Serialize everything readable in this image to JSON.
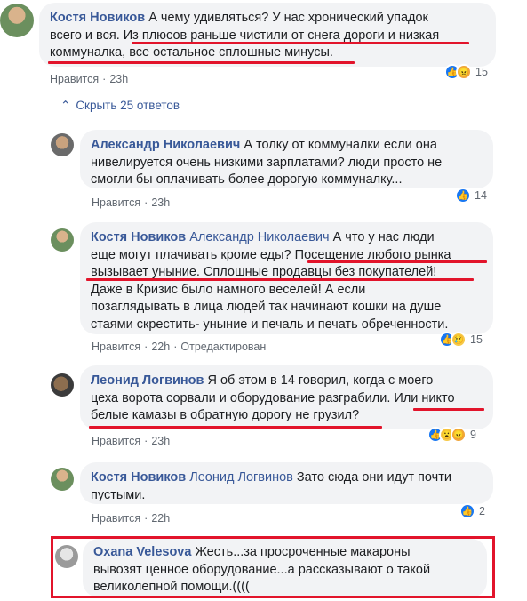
{
  "comments": [
    {
      "author": "Костя Новиков",
      "lines": [
        "А чему удивляться? У нас хронический упадок",
        "всего и вся. Из плюсов раньше чистили от снега дороги и низкая",
        "коммуналка, все остальное сплошные минусы."
      ],
      "line1": "А чему удивляться? У нас хронический упадок",
      "line2a": "всего и вся. ",
      "line2b": "Из плюсов раньше чистили от снега дороги и низкая",
      "line3": "коммуналка, все остальное сплошные минусы.",
      "like_label": "Нравится",
      "time": "23h",
      "reaction_count": "15"
    },
    {
      "hide_replies": "Скрыть 25 ответов"
    },
    {
      "author": "Александр Николаевич",
      "line1": "А толку от коммуналки если она",
      "line2": "нивелируется очень низкими зарплатами? люди просто не",
      "line3": "смогли бы оплачивать более дорогую коммуналку...",
      "like_label": "Нравится",
      "time": "23h",
      "reaction_count": "14"
    },
    {
      "author": "Костя Новиков",
      "mention": "Александр Николаевич",
      "line1": "А что у нас люди",
      "line2a": "еще могут плачивать кроме еды? ",
      "line2b": "Посещение любого рынка",
      "line3": "вызывает уныние. Сплошные продавцы без покупателей!",
      "line4": "Даже в Кризис было намного веселей! А если",
      "line5": "позаглядывать в лица людей так начинают кошки на душе",
      "line6": "стаями скрестить- уныние и печаль и печать обреченности.",
      "like_label": "Нравится",
      "time": "22h",
      "edited": "Отредактирован",
      "reaction_count": "15"
    },
    {
      "author": "Леонид Логвинов",
      "line1": "Я об этом в 14 говорил, когда с моего",
      "line2a": "цеха ворота сорвали и оборудование разграбили. ",
      "line2b": "Или никто",
      "line3": "белые камазы в обратную дорогу не грузил?",
      "like_label": "Нравится",
      "time": "23h",
      "reaction_count": "9"
    },
    {
      "author": "Костя Новиков",
      "mention": "Леонид Логвинов",
      "line1": "Зато сюда они идут почти",
      "line2": "пустыми.",
      "like_label": "Нравится",
      "time": "22h",
      "reaction_count": "2"
    },
    {
      "author": "Oxana Velesova",
      "line1": "Жесть...за просроченные макароны",
      "line2": "вывозят ценное оборудование...а рассказывают о такой",
      "line3": "великолепной помощи.(((("
    }
  ],
  "dot": "·"
}
